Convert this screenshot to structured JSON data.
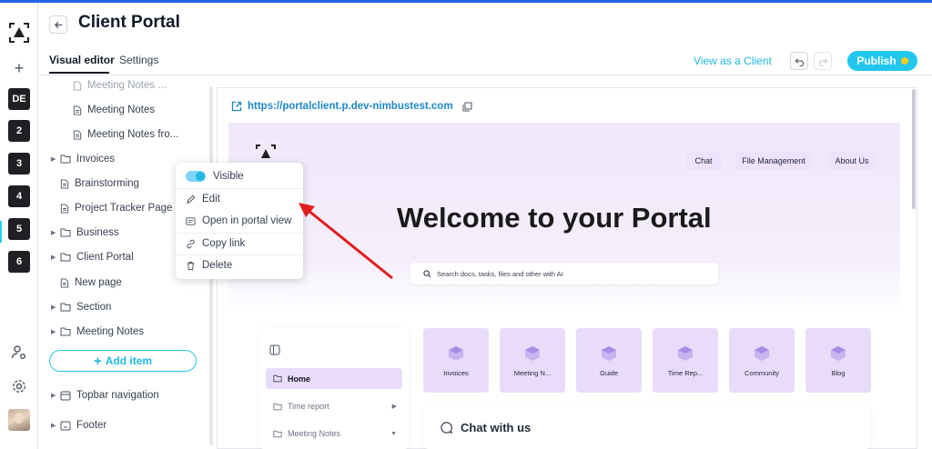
{
  "header": {
    "title": "Client Portal",
    "tabs": [
      {
        "label": "Visual editor",
        "active": true
      },
      {
        "label": "Settings",
        "active": false
      }
    ],
    "view_as_client": "View as a Client",
    "publish_label": "Publish"
  },
  "rail": {
    "workspaces": [
      "DE",
      "2",
      "3",
      "4",
      "5",
      "6"
    ],
    "active_workspace": "5"
  },
  "sidebar": {
    "items": [
      {
        "label": "Meeting Notes ...",
        "icon": "document-icon"
      },
      {
        "label": "Meeting Notes",
        "icon": "document-icon"
      },
      {
        "label": "Meeting Notes fro...",
        "icon": "document-icon"
      },
      {
        "label": "Invoices",
        "icon": "folder-icon"
      },
      {
        "label": "Brainstorming",
        "icon": "document-icon"
      },
      {
        "label": "Project Tracker Page",
        "icon": "document-icon"
      },
      {
        "label": "Business",
        "icon": "folder-icon"
      },
      {
        "label": "Client Portal",
        "icon": "folder-icon"
      },
      {
        "label": "New page",
        "icon": "document-icon"
      },
      {
        "label": "Section",
        "icon": "folder-icon"
      },
      {
        "label": "Meeting Notes",
        "icon": "folder-icon"
      }
    ],
    "add_item": "Add item",
    "topbar_navigation": "Topbar navigation",
    "footer": "Footer"
  },
  "context_menu": {
    "visible_label": "Visible",
    "visible_on": true,
    "edit": "Edit",
    "open_in_portal": "Open in portal view",
    "copy_link": "Copy link",
    "delete": "Delete"
  },
  "preview": {
    "url": "https://portalclient.p.dev-nimbustest.com",
    "nav": [
      "Chat",
      "File Management",
      "About Us"
    ],
    "welcome": "Welcome to your Portal",
    "search_placeholder": "Search docs, tasks, files and other with AI",
    "side": {
      "home": "Home",
      "links": [
        "Time report",
        "Meeting Notes"
      ]
    },
    "cards": [
      "Invoices",
      "Meeting N...",
      "Guide",
      "Time Rep...",
      "Community",
      "Blog"
    ],
    "chat_title": "Chat with us"
  },
  "colors": {
    "accent": "#22c7ee",
    "link": "#1d87c9",
    "hero_bg": "#f1e8fb",
    "card_bg": "#e9dcfa",
    "annotation": "#e11d1d"
  }
}
